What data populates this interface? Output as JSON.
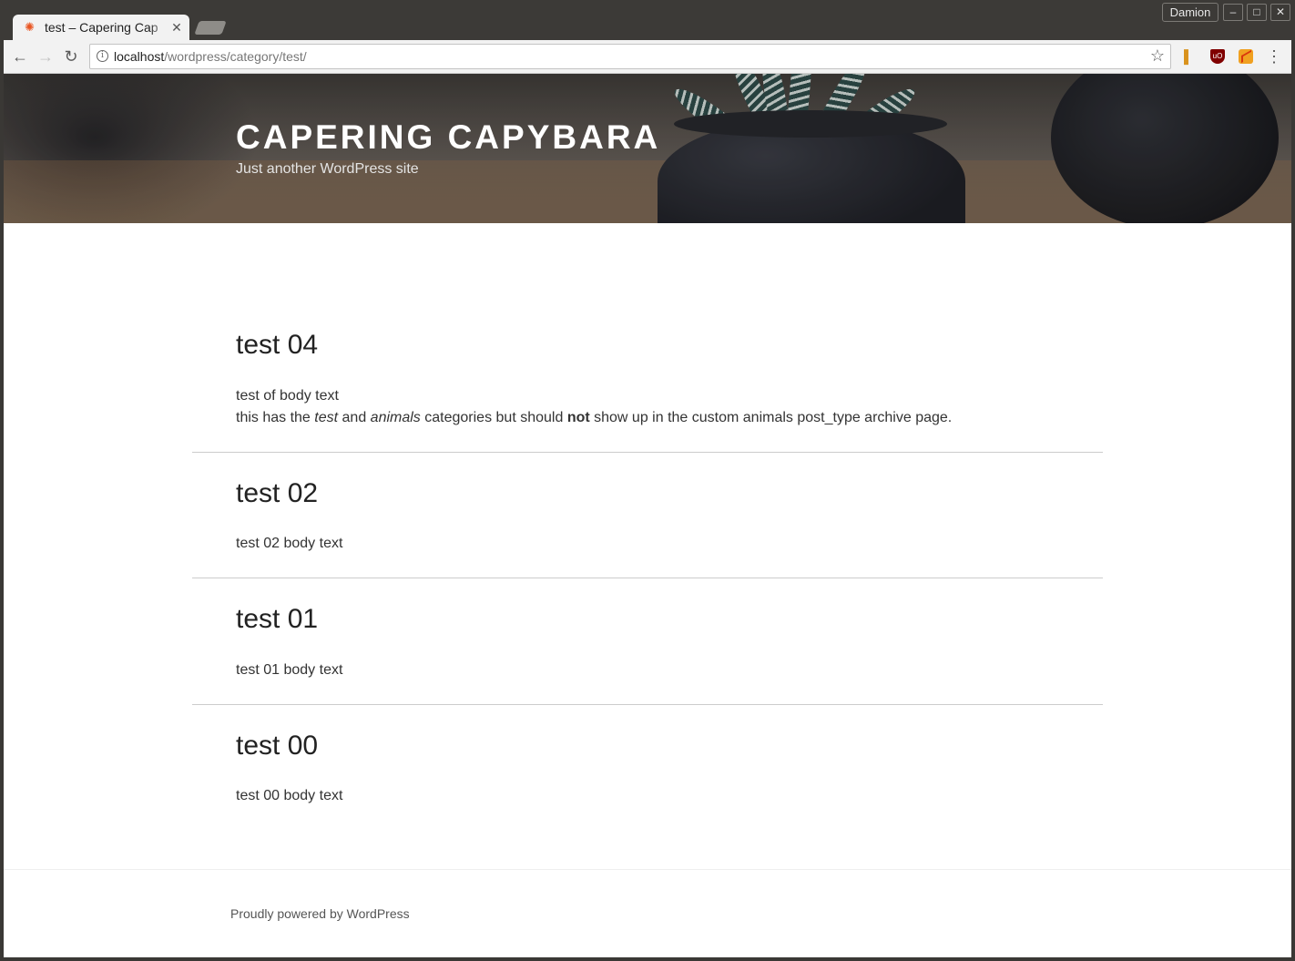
{
  "browser": {
    "tab_title": "test – Capering Cap",
    "profile_name": "Damion",
    "window_controls": {
      "minimize": "–",
      "maximize": "□",
      "close": "✕"
    },
    "url_host": "localhost",
    "url_path": "/wordpress/category/test/",
    "icons": [
      "back-icon",
      "forward-icon",
      "reload-icon",
      "info-icon",
      "star-icon",
      "menu-icon"
    ]
  },
  "site": {
    "title": "CAPERING CAPYBARA",
    "description": "Just another WordPress site"
  },
  "posts": [
    {
      "title": "test 04",
      "body_line1": "test of body text",
      "body_line2": {
        "p1": "this has the ",
        "em1": "test",
        "p2": " and ",
        "em2": "animals",
        "p3": " categories but should ",
        "strong": "not",
        "p4": " show up in the custom animals post_type archive page."
      }
    },
    {
      "title": "test 02",
      "body": "test 02 body text"
    },
    {
      "title": "test 01",
      "body": "test 01 body text"
    },
    {
      "title": "test 00",
      "body": "test 00 body text"
    }
  ],
  "footer": {
    "credit": "Proudly powered by WordPress"
  },
  "colors": {
    "ubuntu_orange": "#e95420",
    "chrome_frame": "#3c3a37"
  }
}
